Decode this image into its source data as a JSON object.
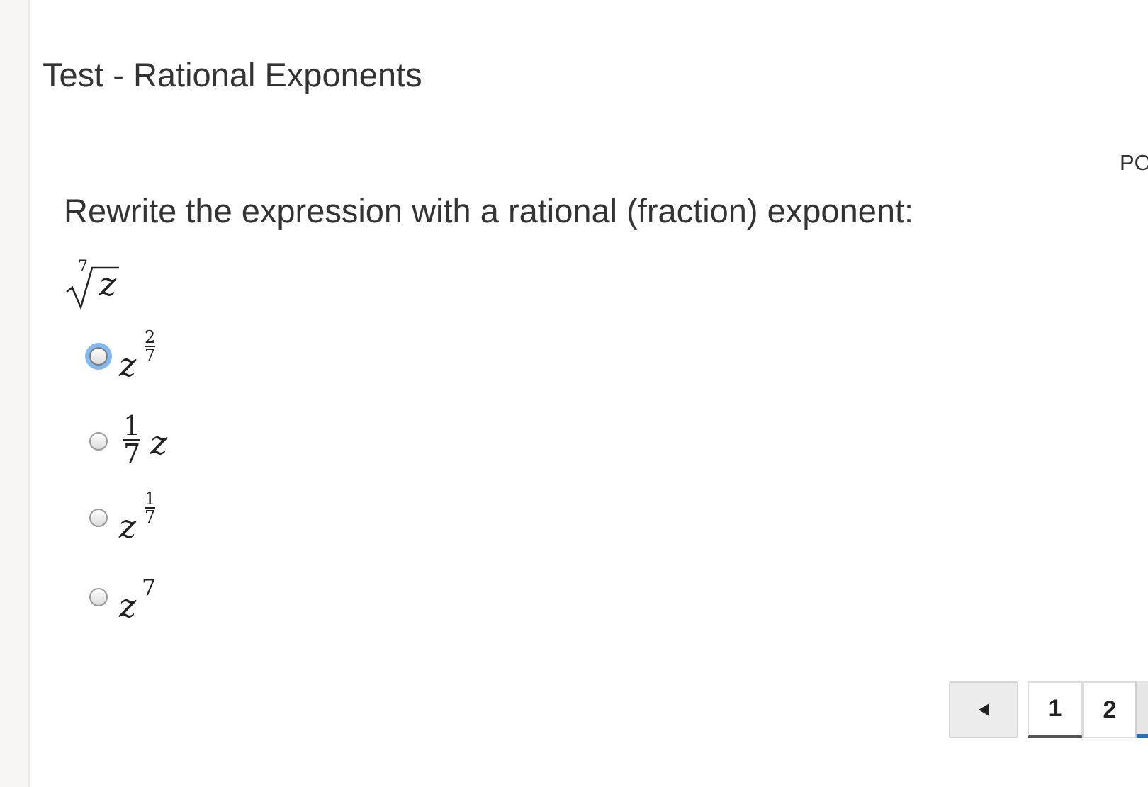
{
  "test": {
    "title": "Test - Rational Exponents"
  },
  "header": {
    "points_label": "PO"
  },
  "question": {
    "prompt": "Rewrite the expression with a rational (fraction) exponent:",
    "expression": {
      "root_index": "7",
      "radicand": "z"
    }
  },
  "options": [
    {
      "base": "z",
      "exp_num": "2",
      "exp_den": "7",
      "selected": false,
      "focused": true
    },
    {
      "coef_num": "1",
      "coef_den": "7",
      "base": "z",
      "selected": false
    },
    {
      "base": "z",
      "exp_num": "1",
      "exp_den": "7",
      "selected": false
    },
    {
      "base": "z",
      "exp": "7",
      "selected": false
    }
  ],
  "pagination": {
    "prev_icon": "left-triangle-icon",
    "pages": [
      "1",
      "2"
    ],
    "current_page": "1"
  }
}
